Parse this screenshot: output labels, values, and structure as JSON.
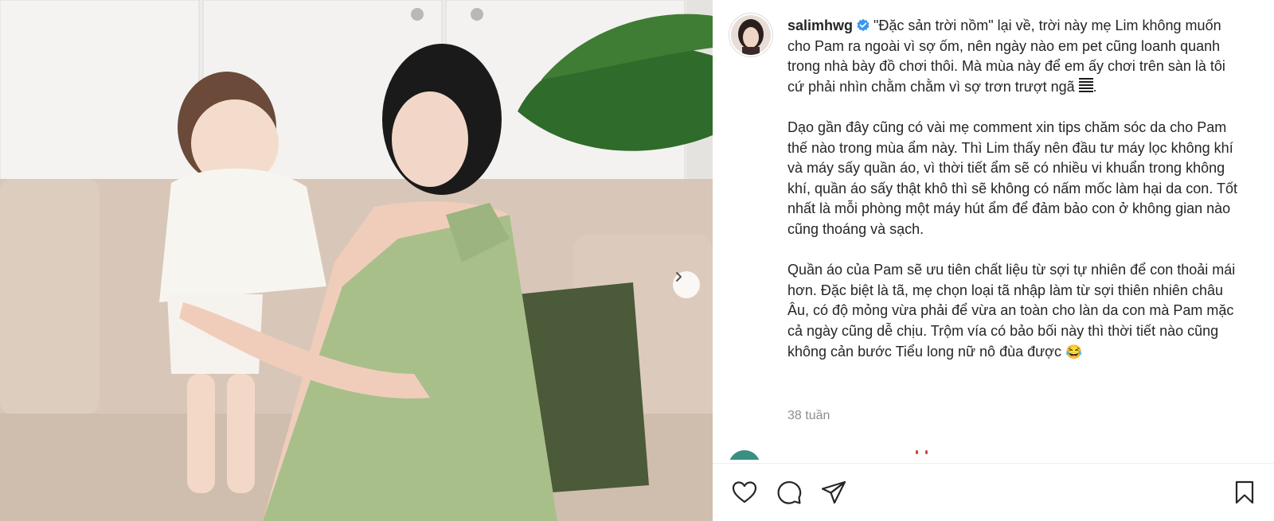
{
  "post": {
    "username": "salimhwg",
    "verified": true,
    "caption_intro": "\"Đặc sản trời nồm\" lại về, trời này mẹ Lim không muốn cho Pam ra ngoài vì sợ ốm, nên ngày nào em pet cũng loanh quanh trong nhà bày đồ chơi thôi. Mà mùa này để em ấy chơi trên sàn là tôi cứ phải nhìn chằm chằm vì sợ trơn trượt ngã ",
    "caption_intro_end": ".",
    "caption_p2": "Dạo gần đây cũng có vài mẹ comment xin tips chăm sóc da cho Pam thế nào trong mùa ẩm này. Thì Lim thấy nên đầu tư máy lọc không khí và máy sấy quần áo, vì thời tiết ẩm sẽ có nhiều vi khuẩn trong không khí, quần áo sấy thật khô thì sẽ không có nấm mốc làm hại da con. Tốt nhất là mỗi phòng một máy hút ẩm để đảm bảo con ở không gian nào cũng thoáng và sạch.",
    "caption_p3": "Quần áo của Pam sẽ ưu tiên chất liệu từ sợi tự nhiên để con thoải mái hơn. Đặc biệt là tã, mẹ chọn loại tã nhập làm từ sợi thiên nhiên châu Âu, có độ mỏng vừa phải để vừa an toàn cho làn da con mà Pam mặc cả ngày cũng dễ chịu. Trộm vía có bảo bối này thì thời tiết nào cũng không cản bước Tiểu long nữ nô đùa được ",
    "caption_p3_emoji": "😂",
    "timestamp": "38 tuần"
  },
  "icons": {
    "verified": "verified-badge-icon",
    "next": "chevron-right-icon",
    "like": "heart-icon",
    "comment": "comment-bubble-icon",
    "share": "paper-plane-icon",
    "save": "bookmark-icon"
  },
  "colors": {
    "verified": "#3897f0",
    "text": "#262626",
    "muted": "#8e8e8e",
    "dress": "#a9bf8a",
    "pillow": "#4b5a38",
    "sofa": "#d9c8b8"
  }
}
